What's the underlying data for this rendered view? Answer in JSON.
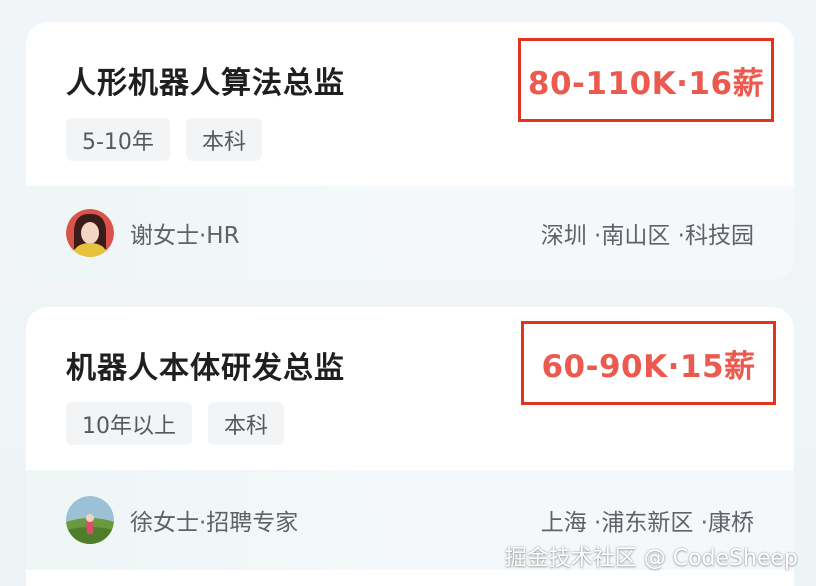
{
  "jobs": [
    {
      "title": "人形机器人算法总监",
      "salary": "80-110K·16薪",
      "tags": [
        "5-10年",
        "本科"
      ],
      "recruiter": "谢女士·HR",
      "location": "深圳 ·南山区 ·科技园"
    },
    {
      "title": "机器人本体研发总监",
      "salary": "60-90K·15薪",
      "tags": [
        "10年以上",
        "本科"
      ],
      "recruiter": "徐女士·招聘专家",
      "location": "上海 ·浦东新区 ·康桥"
    }
  ],
  "watermark": "掘金技术社区 @ CodeSheep",
  "colors": {
    "salary": "#ec5a4f",
    "highlight_box": "#e2341d",
    "title": "#1f1f1f",
    "secondary_text": "#5f6368"
  }
}
